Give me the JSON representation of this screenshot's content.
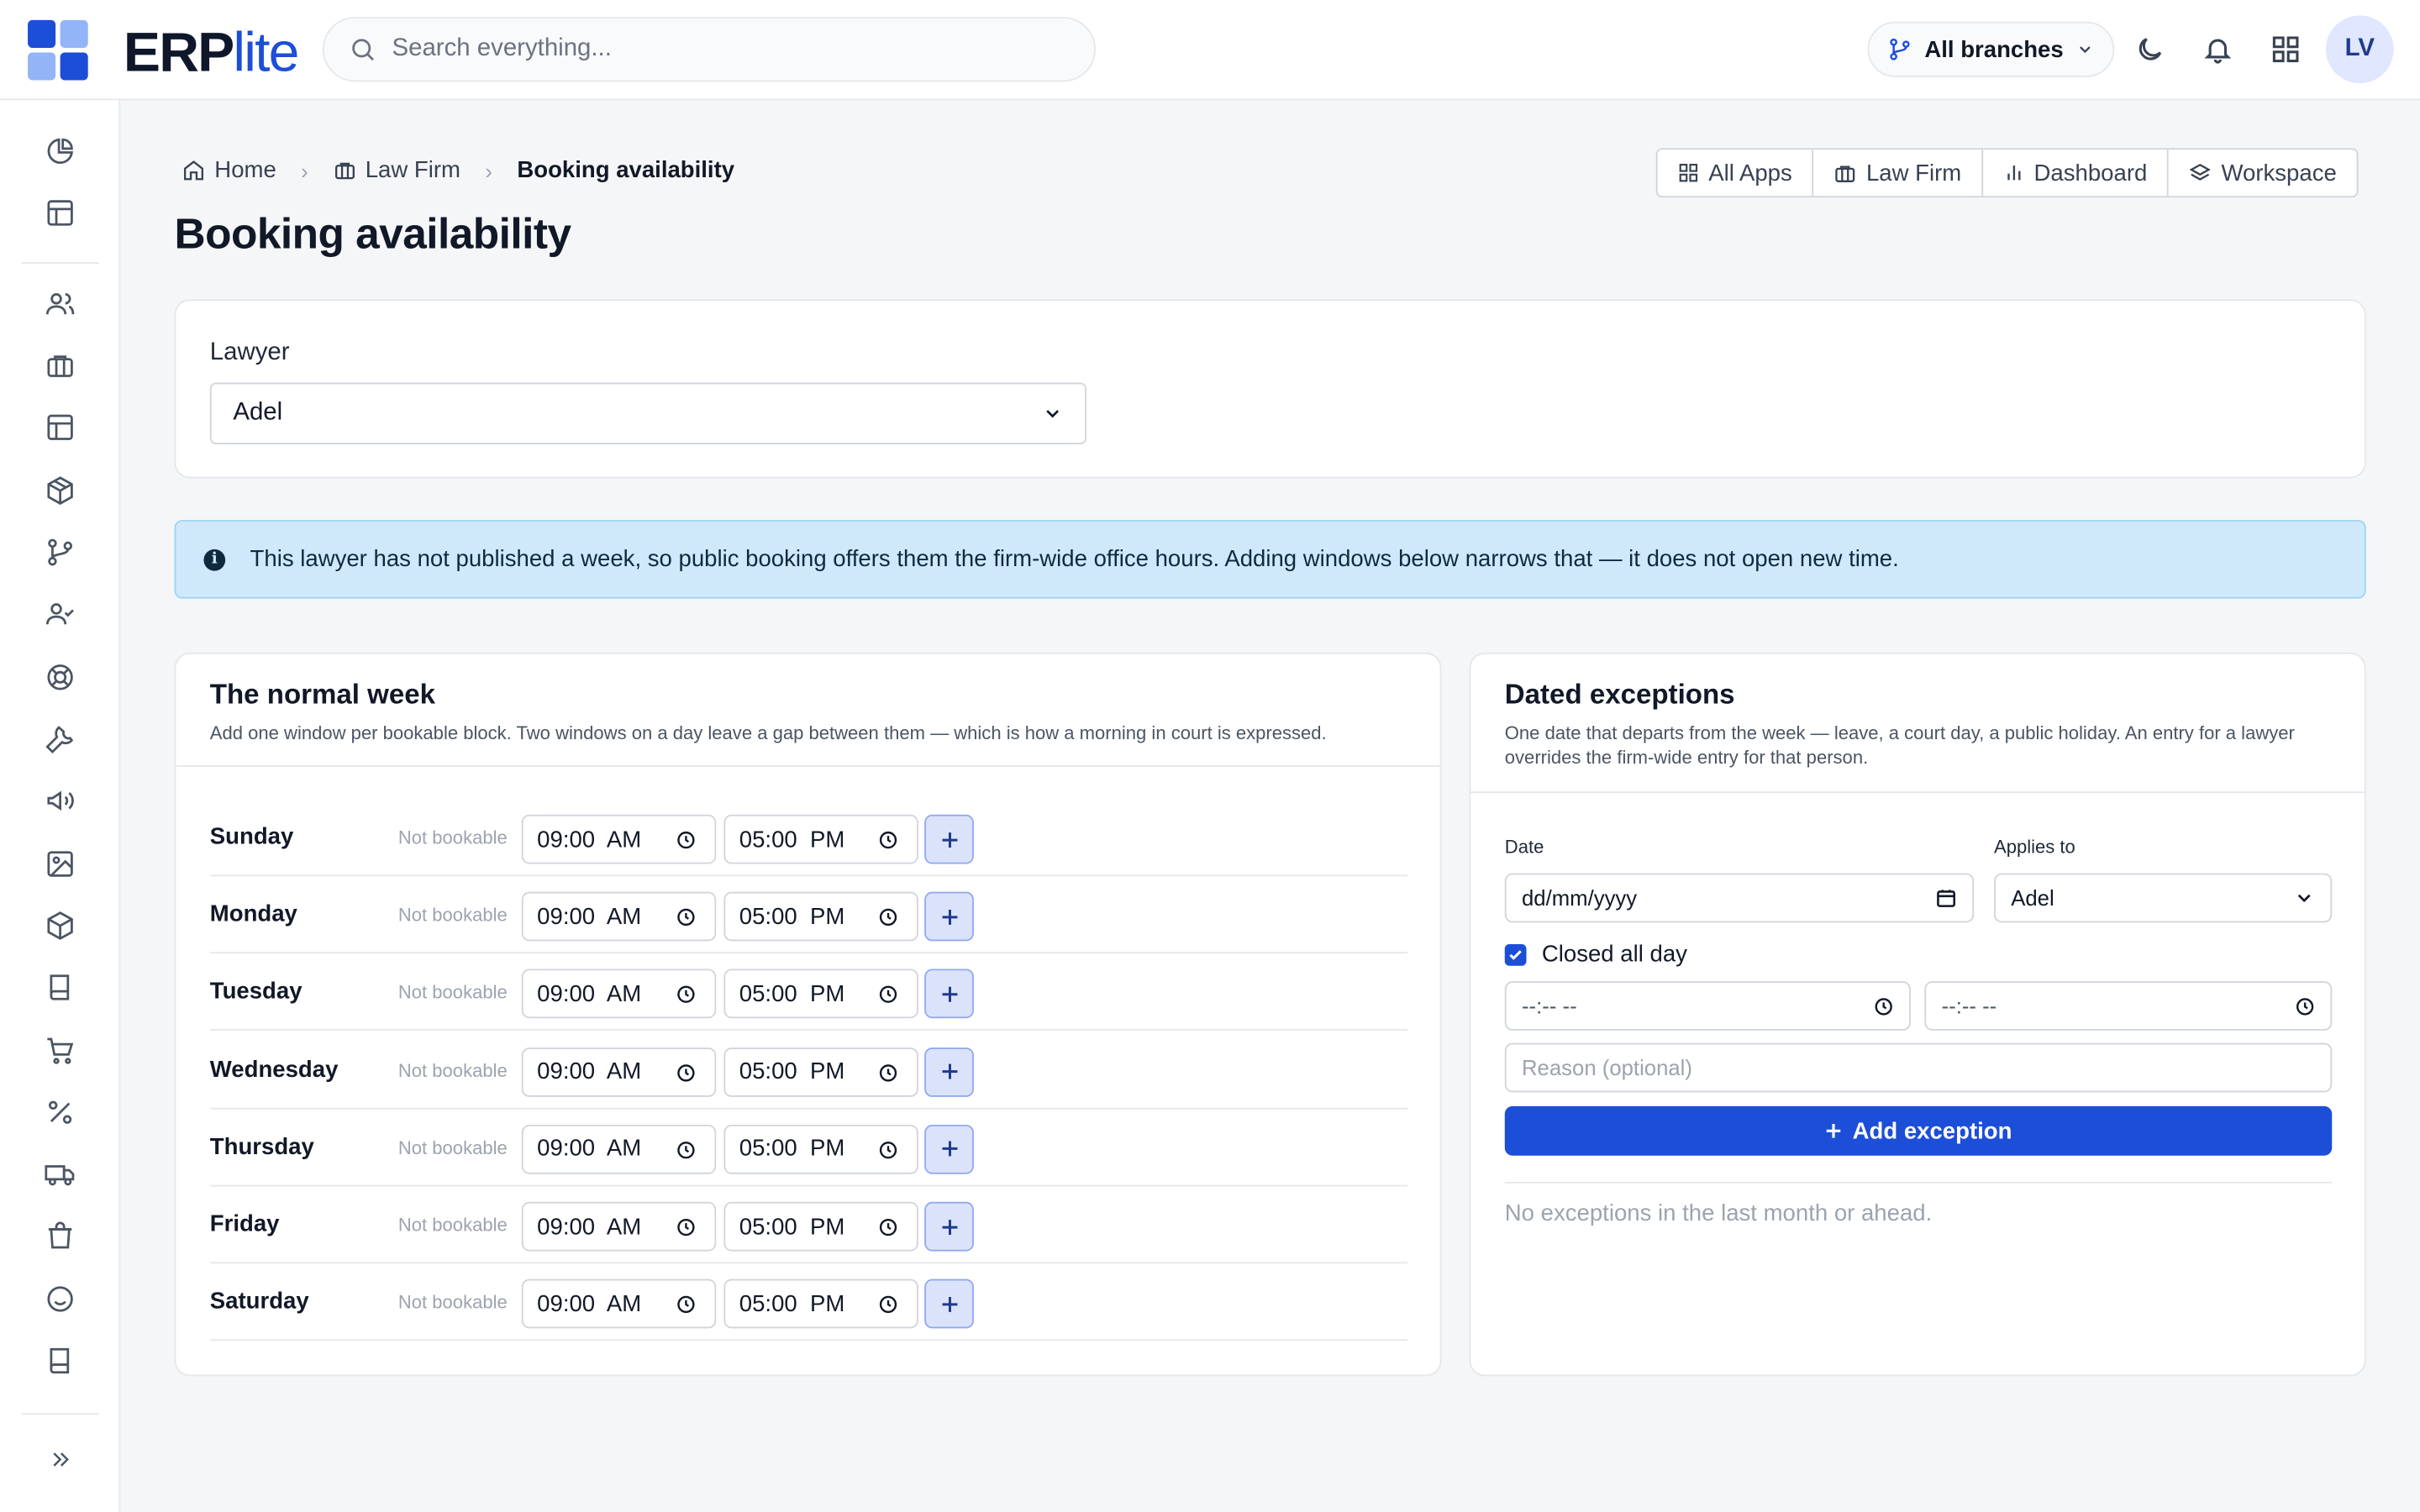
{
  "app": {
    "logo_main": "ERP",
    "logo_suffix": "lite"
  },
  "header": {
    "search_placeholder": "Search everything...",
    "branch_label": "All branches",
    "avatar_initials": "LV"
  },
  "breadcrumb": {
    "home": "Home",
    "section": "Law Firm",
    "current": "Booking availability"
  },
  "page_title": "Booking availability",
  "quicknav": {
    "all_apps": "All Apps",
    "law_firm": "Law Firm",
    "dashboard": "Dashboard",
    "workspace": "Workspace"
  },
  "lawyer": {
    "label": "Lawyer",
    "selected": "Adel"
  },
  "banner": {
    "text": "This lawyer has not published a week, so public booking offers them the firm-wide office hours. Adding windows below narrows that — it does not open new time."
  },
  "week": {
    "title": "The normal week",
    "subtitle": "Add one window per bookable block. Two windows on a day leave a gap between them — which is how a morning in court is expressed.",
    "status": "Not bookable",
    "days": [
      {
        "name": "Sunday",
        "start": "09:00  AM",
        "end": "05:00  PM"
      },
      {
        "name": "Monday",
        "start": "09:00  AM",
        "end": "05:00  PM"
      },
      {
        "name": "Tuesday",
        "start": "09:00  AM",
        "end": "05:00  PM"
      },
      {
        "name": "Wednesday",
        "start": "09:00  AM",
        "end": "05:00  PM"
      },
      {
        "name": "Thursday",
        "start": "09:00  AM",
        "end": "05:00  PM"
      },
      {
        "name": "Friday",
        "start": "09:00  AM",
        "end": "05:00  PM"
      },
      {
        "name": "Saturday",
        "start": "09:00  AM",
        "end": "05:00  PM"
      }
    ]
  },
  "exceptions": {
    "title": "Dated exceptions",
    "subtitle": "One date that departs from the week — leave, a court day, a public holiday. An entry for a lawyer overrides the firm-wide entry for that person.",
    "date_label": "Date",
    "date_placeholder": "dd/mm/yyyy",
    "applies_label": "Applies to",
    "applies_value": "Adel",
    "closed_label": "Closed all day",
    "time_placeholder": "--:-- --",
    "reason_placeholder": "Reason (optional)",
    "add_button": "Add exception",
    "empty": "No exceptions in the last month or ahead."
  },
  "colors": {
    "accent": "#1d4ed8",
    "banner_bg": "#cfe9fb"
  }
}
